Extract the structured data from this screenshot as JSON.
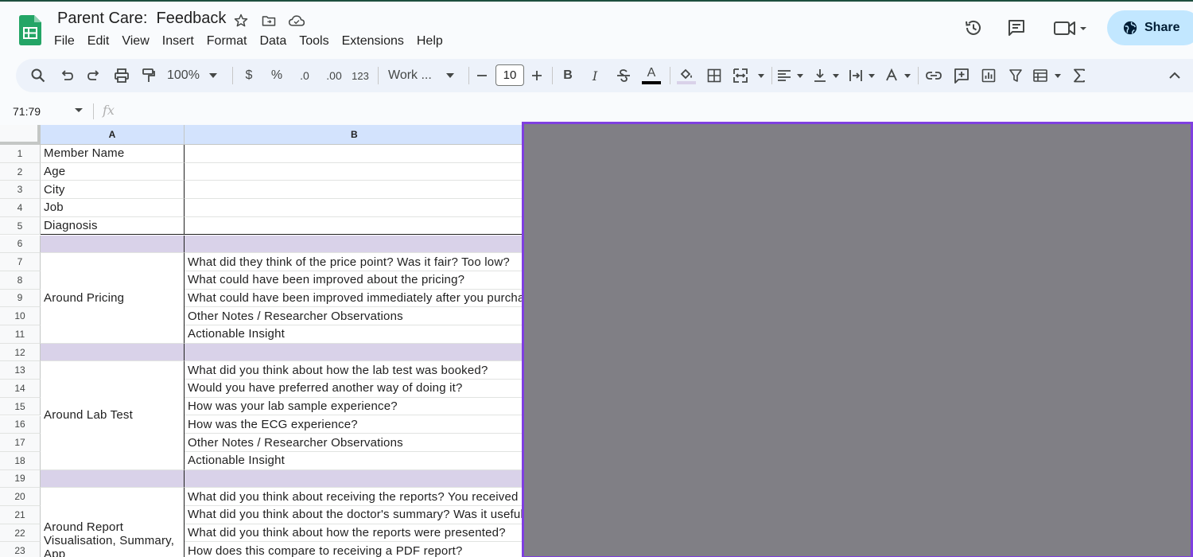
{
  "doc": {
    "title": "Parent Care:  Feedback",
    "menu": [
      "File",
      "Edit",
      "View",
      "Insert",
      "Format",
      "Data",
      "Tools",
      "Extensions",
      "Help"
    ],
    "share_label": "Share"
  },
  "toolbar": {
    "zoom": "100%",
    "currency": "$",
    "percent": "%",
    "decrease_decimal": ".0",
    "increase_decimal": ".00",
    "number_format": "123",
    "font": "Work ...",
    "font_size": "10",
    "bold": "B",
    "italic": "I",
    "text_color": "A"
  },
  "formula_bar": {
    "name_box": "71:79",
    "fx": "fx"
  },
  "columns": [
    "A",
    "B"
  ],
  "rows": [
    {
      "n": "1",
      "a": "Member Name",
      "b": ""
    },
    {
      "n": "2",
      "a": "Age",
      "b": ""
    },
    {
      "n": "3",
      "a": "City",
      "b": ""
    },
    {
      "n": "4",
      "a": "Job",
      "b": ""
    },
    {
      "n": "5",
      "a": "Diagnosis",
      "b": ""
    },
    {
      "n": "6",
      "a": "",
      "b": "",
      "sep": true
    },
    {
      "n": "7",
      "a": "",
      "b": "What did they think of the price point? Was it fair? Too low?"
    },
    {
      "n": "8",
      "a": "",
      "b": "What could have been improved about the pricing?"
    },
    {
      "n": "9",
      "a": "",
      "b": "What could have been improved immediately after you purchased?"
    },
    {
      "n": "10",
      "a": "",
      "b": "Other Notes / Researcher Observations"
    },
    {
      "n": "11",
      "a": "",
      "b": "Actionable Insight"
    },
    {
      "n": "12",
      "a": "",
      "b": "",
      "sep": true
    },
    {
      "n": "13",
      "a": "",
      "b": "What did you think about how the lab test was booked?"
    },
    {
      "n": "14",
      "a": "",
      "b": "Would you have preferred another way of doing it?"
    },
    {
      "n": "15",
      "a": "",
      "b": "How was your lab sample experience?"
    },
    {
      "n": "16",
      "a": "",
      "b": "How was the ECG experience?"
    },
    {
      "n": "17",
      "a": "",
      "b": "Other Notes / Researcher Observations"
    },
    {
      "n": "18",
      "a": "",
      "b": "Actionable Insight"
    },
    {
      "n": "19",
      "a": "",
      "b": "",
      "sep": true
    },
    {
      "n": "20",
      "a": "",
      "b": "What did you think about receiving the reports? You received"
    },
    {
      "n": "21",
      "a": "",
      "b": "What did you think about the doctor's summary? Was it useful?"
    },
    {
      "n": "22",
      "a": "",
      "b": "What did you think about how the reports were presented?"
    },
    {
      "n": "23",
      "a": "",
      "b": "How does this compare to receiving a PDF report?"
    }
  ],
  "groups": [
    {
      "label": "Around Pricing"
    },
    {
      "label": "Around Lab Test"
    },
    {
      "label": "Around Report Visualisation, Summary, App"
    }
  ]
}
